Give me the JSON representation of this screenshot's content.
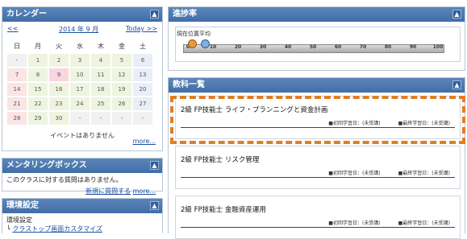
{
  "calendar": {
    "title": "カレンダー",
    "prev": "<<",
    "month": "2014 年 9 月",
    "today": "Today",
    "next": ">>",
    "weekdays": [
      "日",
      "月",
      "火",
      "水",
      "木",
      "金",
      "土"
    ],
    "weeks": [
      [
        "-",
        "1",
        "2",
        "3",
        "4",
        "5",
        "6"
      ],
      [
        "7",
        "8",
        "9",
        "10",
        "11",
        "12",
        "13"
      ],
      [
        "14",
        "15",
        "16",
        "17",
        "18",
        "19",
        "20"
      ],
      [
        "21",
        "22",
        "23",
        "24",
        "25",
        "26",
        "27"
      ],
      [
        "28",
        "29",
        "30",
        "-",
        "-",
        "-",
        "-"
      ]
    ],
    "no_events": "イベントはありません",
    "more": "more..."
  },
  "mentoring": {
    "title": "メンタリングボックス",
    "message": "このクラスに対する質問はありません。",
    "ask_link": "新規に質問する",
    "more": "more..."
  },
  "environment": {
    "title": "環境設定",
    "label": "環境設定",
    "link": "クラストップ画面カスタマイズ"
  },
  "progress": {
    "title": "進捗率",
    "legend_label": "現在位置平均",
    "ticks": [
      "0",
      "10",
      "20",
      "30",
      "40",
      "50",
      "60",
      "70",
      "80",
      "90",
      "100"
    ]
  },
  "courses": {
    "title": "教科一覧",
    "items": [
      {
        "title": "2級 FP技能士 ライフ・プランニングと資金計画",
        "first": "■初回学習日：(未受講)",
        "last": "■最終学習日：(未受講)"
      },
      {
        "title": "2級 FP技能士 リスク管理",
        "first": "■初回学習日：(未受講)",
        "last": "■最終学習日：(未受講)"
      },
      {
        "title": "2級 FP技能士 金融資産運用",
        "first": "■初回学習日：(未受講)",
        "last": "■最終学習日：(未受講)"
      }
    ]
  },
  "colors": {
    "header": "#4a79b3",
    "callout": "#e07e22",
    "marker_current": "#e99b3a",
    "marker_avg": "#7fb0e0"
  }
}
